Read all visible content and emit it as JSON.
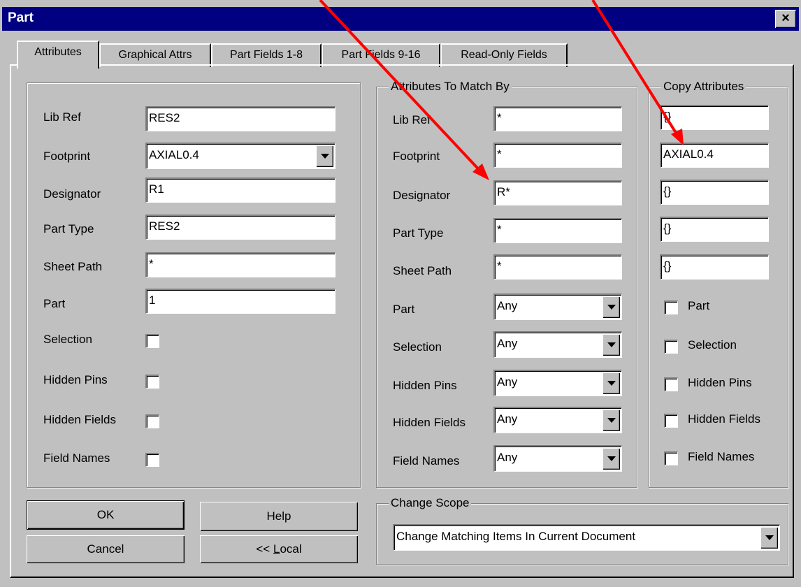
{
  "window": {
    "title": "Part",
    "close_glyph": "×"
  },
  "tabs": [
    {
      "label": "Attributes",
      "active": true
    },
    {
      "label": "Graphical Attrs"
    },
    {
      "label": "Part Fields 1-8"
    },
    {
      "label": "Part Fields 9-16"
    },
    {
      "label": "Read-Only Fields"
    }
  ],
  "attributes": {
    "lib_ref": {
      "label": "Lib Ref",
      "value": "RES2"
    },
    "footprint": {
      "label": "Footprint",
      "value": "AXIAL0.4"
    },
    "designator": {
      "label": "Designator",
      "value": "R1"
    },
    "part_type": {
      "label": "Part Type",
      "value": "RES2"
    },
    "sheet_path": {
      "label": "Sheet Path",
      "value": "*"
    },
    "part": {
      "label": "Part",
      "value": "1"
    },
    "selection": {
      "label": "Selection",
      "checked": false
    },
    "hidden_pins": {
      "label": "Hidden Pins",
      "checked": false
    },
    "hidden_fields": {
      "label": "Hidden Fields",
      "checked": false
    },
    "field_names": {
      "label": "Field Names",
      "checked": false
    }
  },
  "match": {
    "title": "Attributes To Match By",
    "lib_ref": {
      "label": "Lib Ref",
      "value": "*"
    },
    "footprint": {
      "label": "Footprint",
      "value": "*"
    },
    "designator": {
      "label": "Designator",
      "value": "R*"
    },
    "part_type": {
      "label": "Part Type",
      "value": "*"
    },
    "sheet_path": {
      "label": "Sheet Path",
      "value": "*"
    },
    "part": {
      "label": "Part",
      "value": "Any"
    },
    "selection": {
      "label": "Selection",
      "value": "Any"
    },
    "hidden_pins": {
      "label": "Hidden Pins",
      "value": "Any"
    },
    "hidden_fields": {
      "label": "Hidden Fields",
      "value": "Any"
    },
    "field_names": {
      "label": "Field Names",
      "value": "Any"
    }
  },
  "copy": {
    "title": "Copy Attributes",
    "lib_ref": "{}",
    "footprint": "AXIAL0.4",
    "designator": "{}",
    "part_type": "{}",
    "sheet_path": "{}",
    "part_label": "Part",
    "selection_label": "Selection",
    "hidden_pins_label": "Hidden Pins",
    "hidden_fields_label": "Hidden Fields",
    "field_names_label": "Field Names"
  },
  "scope": {
    "title": "Change Scope",
    "value": "Change Matching Items In Current Document"
  },
  "buttons": {
    "ok": "OK",
    "help": "Help",
    "cancel": "Cancel",
    "local_prefix": "<< ",
    "local_accel": "L",
    "local_rest": "ocal"
  },
  "colors": {
    "title_bar": "#000080",
    "face": "#c0c0c0",
    "annotation_arrow": "#ff0000"
  },
  "icons": {
    "close": "close-icon",
    "dropdown": "chevron-down-icon",
    "arrow": "red-arrow-annotation"
  }
}
